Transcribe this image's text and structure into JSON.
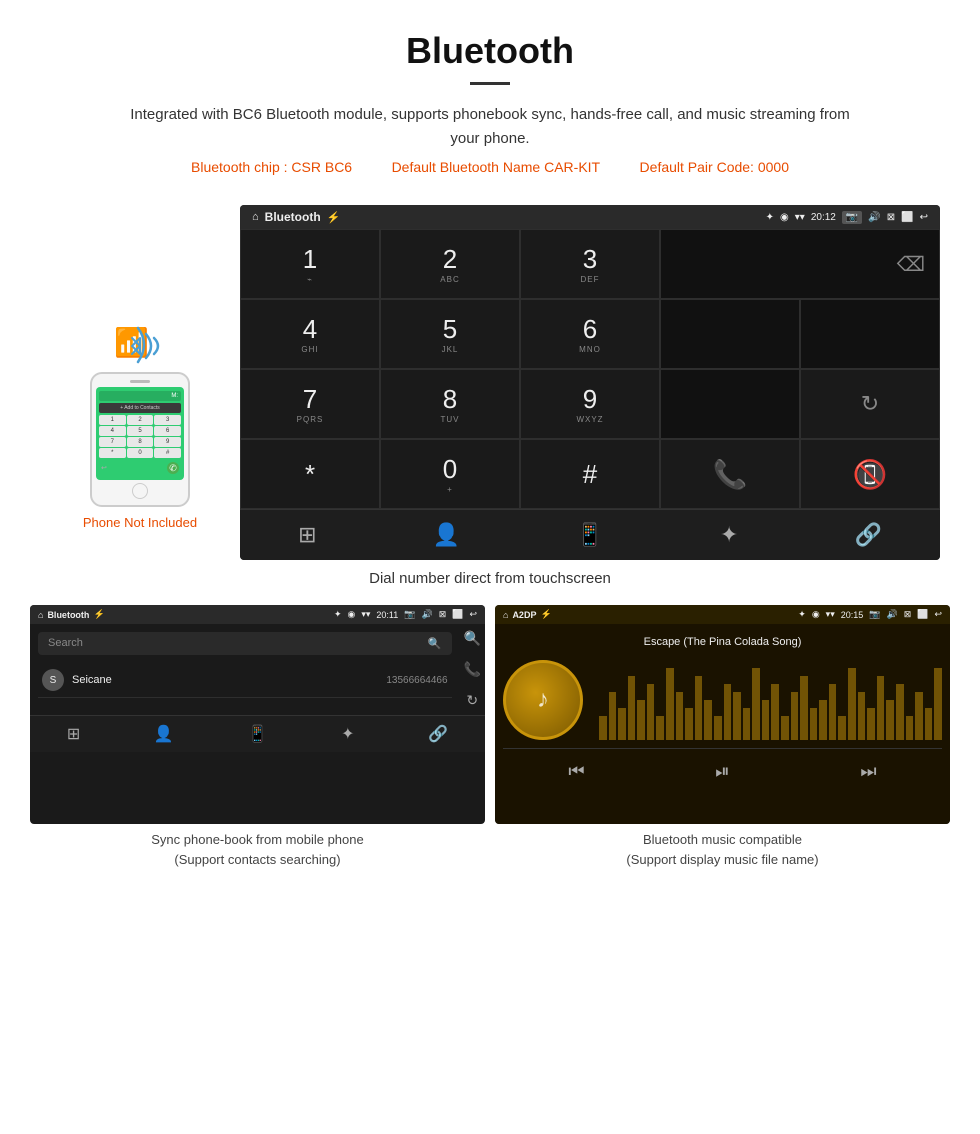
{
  "header": {
    "title": "Bluetooth",
    "description": "Integrated with BC6 Bluetooth module, supports phonebook sync, hands-free call, and music streaming from your phone.",
    "specs_chip": "Bluetooth chip : CSR BC6",
    "specs_name": "Default Bluetooth Name CAR-KIT",
    "specs_code": "Default Pair Code: 0000"
  },
  "phone_mockup": {
    "not_included_label": "Phone Not Included"
  },
  "dial_screen": {
    "status_bar": {
      "app_name": "Bluetooth",
      "usb_icon": "⚡",
      "bluetooth_icon": "✦",
      "location_icon": "◉",
      "wifi_icon": "▾",
      "time": "20:12",
      "camera_icon": "📷",
      "volume_icon": "🔊",
      "close_icon": "✕",
      "window_icon": "⬜",
      "back_icon": "↩"
    },
    "keypad": [
      {
        "num": "1",
        "sub": "⌁"
      },
      {
        "num": "2",
        "sub": "ABC"
      },
      {
        "num": "3",
        "sub": "DEF"
      },
      {
        "num": "4",
        "sub": "GHI"
      },
      {
        "num": "5",
        "sub": "JKL"
      },
      {
        "num": "6",
        "sub": "MNO"
      },
      {
        "num": "7",
        "sub": "PQRS"
      },
      {
        "num": "8",
        "sub": "TUV"
      },
      {
        "num": "9",
        "sub": "WXYZ"
      },
      {
        "num": "*",
        "sub": ""
      },
      {
        "num": "0",
        "sub": "+"
      },
      {
        "num": "#",
        "sub": ""
      }
    ],
    "caption": "Dial number direct from touchscreen"
  },
  "contacts_screen": {
    "status_bar": {
      "home": "⌂",
      "app_name": "Bluetooth",
      "usb": "⚡",
      "bluetooth": "✦",
      "location": "◉",
      "wifi": "▾",
      "time": "20:11",
      "camera": "📷",
      "volume": "🔊",
      "close": "✕",
      "window": "⬜",
      "back": "↩"
    },
    "search_placeholder": "Search",
    "contacts": [
      {
        "initial": "S",
        "name": "Seicane",
        "phone": "13566664466"
      }
    ],
    "caption_line1": "Sync phone-book from mobile phone",
    "caption_line2": "(Support contacts searching)"
  },
  "music_screen": {
    "status_bar": {
      "home": "⌂",
      "app_name": "A2DP",
      "usb": "⚡",
      "bluetooth": "✦",
      "location": "◉",
      "wifi": "▾",
      "time": "20:15",
      "camera": "📷",
      "volume": "🔊",
      "close": "✕",
      "window": "⬜",
      "back": "↩"
    },
    "song_title": "Escape (The Pina Colada Song)",
    "eq_bars": [
      3,
      6,
      4,
      8,
      5,
      7,
      3,
      9,
      6,
      4,
      8,
      5,
      3,
      7,
      6,
      4,
      9,
      5,
      7,
      3,
      6,
      8,
      4,
      5,
      7,
      3,
      9,
      6,
      4,
      8,
      5,
      7,
      3,
      6,
      4,
      9
    ],
    "caption_line1": "Bluetooth music compatible",
    "caption_line2": "(Support display music file name)"
  },
  "colors": {
    "accent_orange": "#e84c00",
    "android_bg": "#1a1a1a",
    "android_statusbar": "#2a2a2a",
    "green_call": "#4caf50",
    "red_hangup": "#f44336",
    "bluetooth_blue": "#4a9fd4"
  }
}
